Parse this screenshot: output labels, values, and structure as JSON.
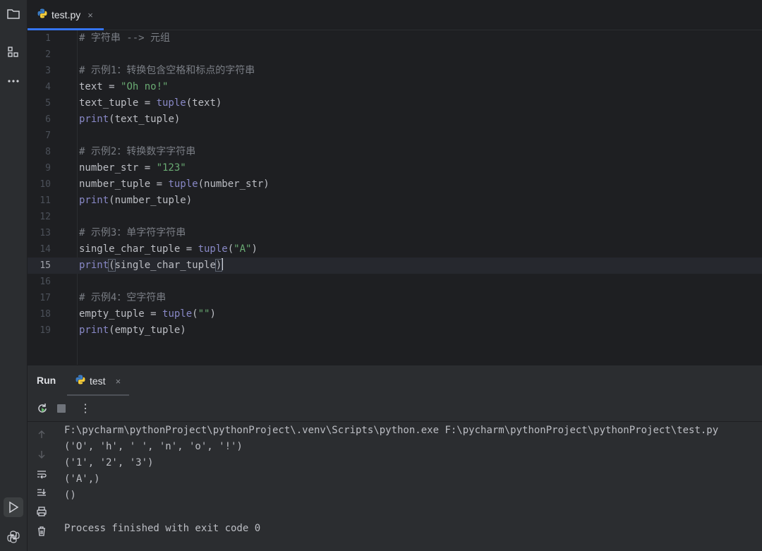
{
  "activity_bar": {
    "items": [
      {
        "icon": "folder-icon"
      },
      {
        "icon": "structure-icon"
      },
      {
        "icon": "more-icon"
      },
      {
        "icon": "run-icon"
      },
      {
        "icon": "python-console-icon"
      }
    ]
  },
  "editor_tab": {
    "label": "test.py",
    "close": "×"
  },
  "code_lines": [
    {
      "num": "1",
      "text": "# 字符串 --> 元组"
    },
    {
      "num": "2",
      "text": ""
    },
    {
      "num": "3",
      "text": "# 示例1：转换包含空格和标点的字符串"
    },
    {
      "num": "4",
      "text": "text = \"Oh no!\""
    },
    {
      "num": "5",
      "text": "text_tuple = tuple(text)"
    },
    {
      "num": "6",
      "text": "print(text_tuple)"
    },
    {
      "num": "7",
      "text": ""
    },
    {
      "num": "8",
      "text": "# 示例2：转换数字字符串"
    },
    {
      "num": "9",
      "text": "number_str = \"123\""
    },
    {
      "num": "10",
      "text": "number_tuple = tuple(number_str)"
    },
    {
      "num": "11",
      "text": "print(number_tuple)"
    },
    {
      "num": "12",
      "text": ""
    },
    {
      "num": "13",
      "text": "# 示例3：单字符字符串"
    },
    {
      "num": "14",
      "text": "single_char_tuple = tuple(\"A\")"
    },
    {
      "num": "15",
      "text": "print(single_char_tuple)"
    },
    {
      "num": "16",
      "text": ""
    },
    {
      "num": "17",
      "text": "# 示例4：空字符串"
    },
    {
      "num": "18",
      "text": "empty_tuple = tuple(\"\")"
    },
    {
      "num": "19",
      "text": "print(empty_tuple)"
    }
  ],
  "current_line": "15",
  "run_panel": {
    "title": "Run",
    "tab_label": "test",
    "tab_close": "×",
    "more": "⋮"
  },
  "console_lines": [
    "F:\\pycharm\\pythonProject\\pythonProject\\.venv\\Scripts\\python.exe F:\\pycharm\\pythonProject\\pythonProject\\test.py",
    "('O', 'h', ' ', 'n', 'o', '!')",
    "('1', '2', '3')",
    "('A',)",
    "()",
    "",
    "Process finished with exit code 0"
  ]
}
